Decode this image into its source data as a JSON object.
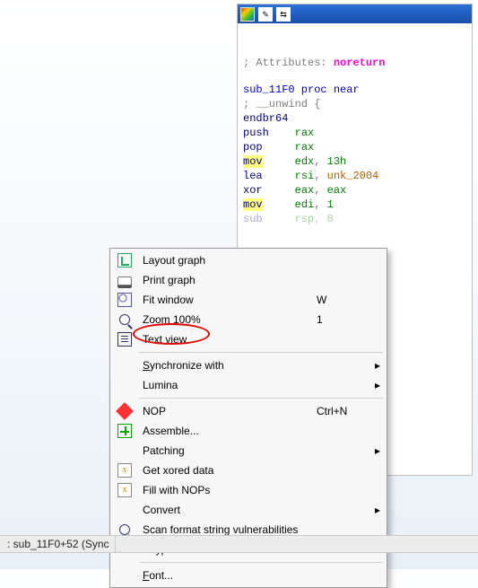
{
  "codeWindow": {
    "titlebarIcons": [
      "palette-icon",
      "edit-icon",
      "toggle-icon"
    ],
    "lines": {
      "comment1": "; Attributes: ",
      "noreturn": "noreturn",
      "label": "sub_11F0 proc near",
      "unwind": "; __unwind {",
      "endbr": "endbr64",
      "push": {
        "mnem": "push",
        "op": "rax"
      },
      "pop": {
        "mnem": "pop",
        "op": "rax"
      },
      "mov1": {
        "mnem": "mov",
        "op1": "edx",
        "op2": "13h"
      },
      "lea": {
        "mnem": "lea",
        "op1": "rsi",
        "op2": "unk_2004"
      },
      "xor": {
        "mnem": "xor",
        "op1": "eax",
        "op2": "eax"
      },
      "mov2": {
        "mnem": "mov",
        "op1": "edi",
        "op2": "1"
      },
      "sub": {
        "mnem": "sub",
        "op1": "rsp",
        "op2": "8"
      }
    }
  },
  "menu": {
    "layoutGraph": "Layout graph",
    "printGraph": "Print graph",
    "fitWindow": "Fit window",
    "fitWindowKey": "W",
    "zoom100": "Zoom 100%",
    "zoom100Key": "1",
    "textView": "Text view",
    "syncWith": "Synchronize with",
    "lumina": "Lumina",
    "nop": "NOP",
    "nopKey": "Ctrl+N",
    "assemble": "Assemble...",
    "patching": "Patching",
    "getXored": "Get xored data",
    "fillNops": "Fill with NOPs",
    "convert": "Convert",
    "scanFmt": "Scan format string vulnerabilities",
    "keypatch": "Keypatch",
    "font": "Font..."
  },
  "status": {
    "text": ": sub_11F0+52 (Sync"
  }
}
